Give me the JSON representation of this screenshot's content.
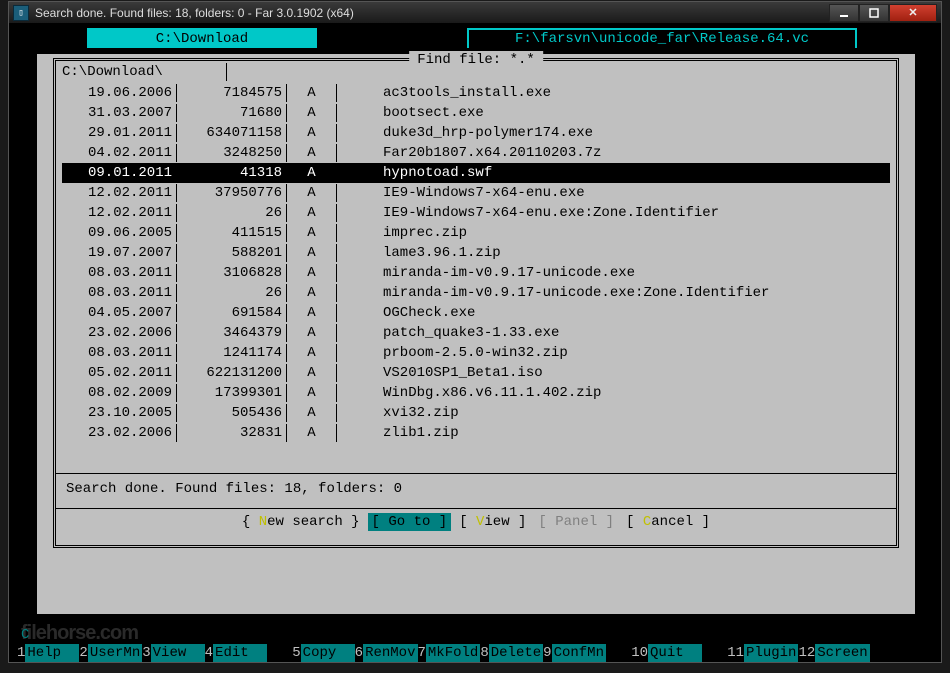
{
  "window": {
    "title": "Search done. Found files: 18, folders: 0 - Far 3.0.1902 (x64)"
  },
  "tabs": {
    "left": "C:\\Download",
    "right": "F:\\farsvn\\unicode_far\\Release.64.vc"
  },
  "dialog": {
    "title": " Find file: *.* ",
    "path": "C:\\Download\\",
    "status": "Search done. Found files: 18, folders: 0",
    "selected_index": 4,
    "rows": [
      {
        "date": "19.06.2006",
        "size": "7184575",
        "attr": "A",
        "name": "ac3tools_install.exe"
      },
      {
        "date": "31.03.2007",
        "size": "71680",
        "attr": "A",
        "name": "bootsect.exe"
      },
      {
        "date": "29.01.2011",
        "size": "634071158",
        "attr": "A",
        "name": "duke3d_hrp-polymer174.exe"
      },
      {
        "date": "04.02.2011",
        "size": "3248250",
        "attr": "A",
        "name": "Far20b1807.x64.20110203.7z"
      },
      {
        "date": "09.01.2011",
        "size": "41318",
        "attr": "A",
        "name": "hypnotoad.swf"
      },
      {
        "date": "12.02.2011",
        "size": "37950776",
        "attr": "A",
        "name": "IE9-Windows7-x64-enu.exe"
      },
      {
        "date": "12.02.2011",
        "size": "26",
        "attr": "A",
        "name": "IE9-Windows7-x64-enu.exe:Zone.Identifier"
      },
      {
        "date": "09.06.2005",
        "size": "411515",
        "attr": "A",
        "name": "imprec.zip"
      },
      {
        "date": "19.07.2007",
        "size": "588201",
        "attr": "A",
        "name": "lame3.96.1.zip"
      },
      {
        "date": "08.03.2011",
        "size": "3106828",
        "attr": "A",
        "name": "miranda-im-v0.9.17-unicode.exe"
      },
      {
        "date": "08.03.2011",
        "size": "26",
        "attr": "A",
        "name": "miranda-im-v0.9.17-unicode.exe:Zone.Identifier"
      },
      {
        "date": "04.05.2007",
        "size": "691584",
        "attr": "A",
        "name": "OGCheck.exe"
      },
      {
        "date": "23.02.2006",
        "size": "3464379",
        "attr": "A",
        "name": "patch_quake3-1.33.exe"
      },
      {
        "date": "08.03.2011",
        "size": "1241174",
        "attr": "A",
        "name": "prboom-2.5.0-win32.zip"
      },
      {
        "date": "05.02.2011",
        "size": "622131200",
        "attr": "A",
        "name": "VS2010SP1_Beta1.iso"
      },
      {
        "date": "08.02.2009",
        "size": "17399301",
        "attr": "A",
        "name": "WinDbg.x86.v6.11.1.402.zip"
      },
      {
        "date": "23.10.2005",
        "size": "505436",
        "attr": "A",
        "name": "xvi32.zip"
      },
      {
        "date": "23.02.2006",
        "size": "32831",
        "attr": "A",
        "name": "zlib1.zip"
      }
    ],
    "buttons": {
      "new_search": {
        "pre": "{ ",
        "hk": "N",
        "rest": "ew search }"
      },
      "goto": {
        "pre": "[ ",
        "hk": "G",
        "rest": "o to ]"
      },
      "view": {
        "pre": "[ ",
        "hk": "V",
        "rest": "iew ]"
      },
      "panel": {
        "pre": "[ ",
        "hk": "",
        "rest": "Panel ]"
      },
      "cancel": {
        "pre": "[ ",
        "hk": "C",
        "rest": "ancel ]"
      }
    }
  },
  "bottom_prompt": "C",
  "fkeys": [
    {
      "n": "1",
      "l": "Help  "
    },
    {
      "n": "2",
      "l": "UserMn"
    },
    {
      "n": "3",
      "l": "View  "
    },
    {
      "n": "4",
      "l": "Edit  "
    },
    {
      "n": "5",
      "l": "Copy  "
    },
    {
      "n": "6",
      "l": "RenMov"
    },
    {
      "n": "7",
      "l": "MkFold"
    },
    {
      "n": "8",
      "l": "Delete"
    },
    {
      "n": "9",
      "l": "ConfMn"
    },
    {
      "n": "10",
      "l": "Quit  "
    },
    {
      "n": "11",
      "l": "Plugin"
    },
    {
      "n": "12",
      "l": "Screen"
    }
  ],
  "watermark": "filehorse.com"
}
